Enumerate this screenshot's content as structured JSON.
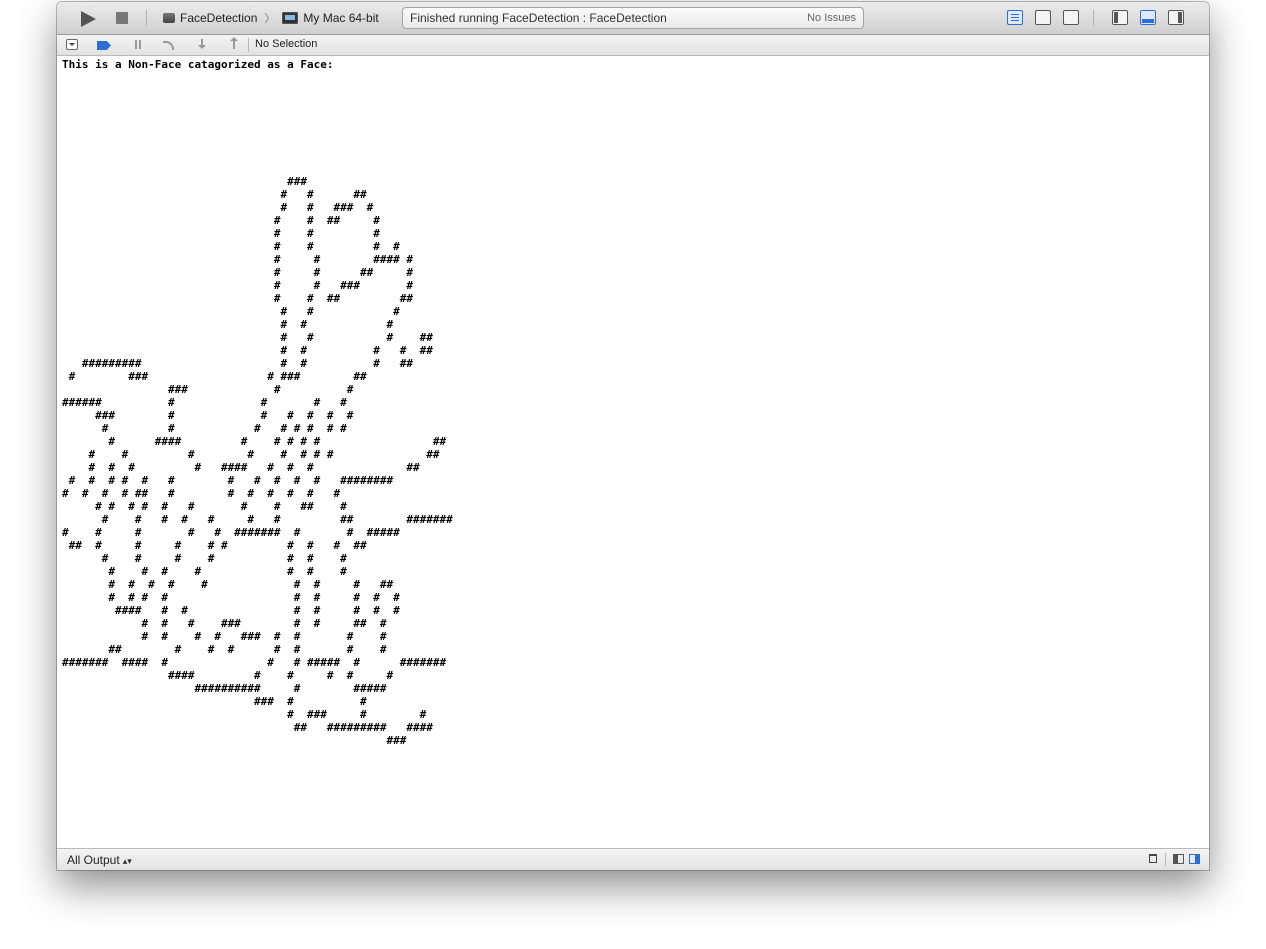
{
  "toolbar": {
    "scheme": "FaceDetection",
    "destination": "My Mac 64-bit",
    "activity_status": "Finished running FaceDetection : FaceDetection",
    "issues": "No Issues"
  },
  "debug_bar": {
    "selection": "No Selection"
  },
  "console": {
    "lines": [
      "This is a Non-Face catagorized as a Face:",
      "",
      "",
      "",
      "",
      "",
      "",
      "",
      "",
      "                                  ###",
      "                                 #   #      ##",
      "                                 #   #   ###  #",
      "                                #    #  ##     #",
      "                                #    #         #",
      "                                #    #         #  #",
      "                                #     #        #### #",
      "                                #     #      ##     #",
      "                                #     #   ###       #",
      "                                #    #  ##         ##",
      "                                 #   #            #",
      "                                 #  #            #",
      "                                 #   #           #    ##",
      "                                 #  #          #   #  ##",
      "   #########                     #  #          #   ##",
      " #        ###                  # ###        ##",
      "                ###             #          #",
      "######          #             #       #   #",
      "     ###        #             #   #  #  #  #",
      "      #         #            #   # # #  # #",
      "       #      ####         #    # # # #                 ##",
      "    #    #         #        #    #  # # #              ##",
      "    #  #  #         #   ####   #  #  #              ##",
      " #  #  # #  #   #        #   #  #  #  #   ########",
      "#  #  #  # ##   #        #  #  #  #  #   #",
      "     # #  # #  #   #       #    #   ##    #",
      "      #    #   #  #   #     #   #         ##        #######",
      "#    #     #       #   #  #######  #       #  #####",
      " ##  #     #     #    # #         #  #   #  ##",
      "      #    #     #    #           #  #    #",
      "       #    #  #    #             #  #    #",
      "       #  #  #  #    #             #  #     #   ##",
      "       #  # #  #                   #  #     #  #  #",
      "        ####   #  #                #  #     #  #  #",
      "            #  #   #    ###        #  #     ##  #",
      "            #  #    #  #   ###  #  #       #    #",
      "       ##        #    #  #      #  #       #    #",
      "#######  ####  #               #   # #####  #      #######",
      "                ####         #    #     #  #     #",
      "                    ##########     #        #####",
      "                             ###  #          #",
      "                                  #  ###     #        #",
      "                                   ##   #########   ####",
      "                                                 ###"
    ]
  },
  "bottom_bar": {
    "output_filter": "All Output"
  },
  "colors": {
    "accent": "#2b6fd6"
  }
}
